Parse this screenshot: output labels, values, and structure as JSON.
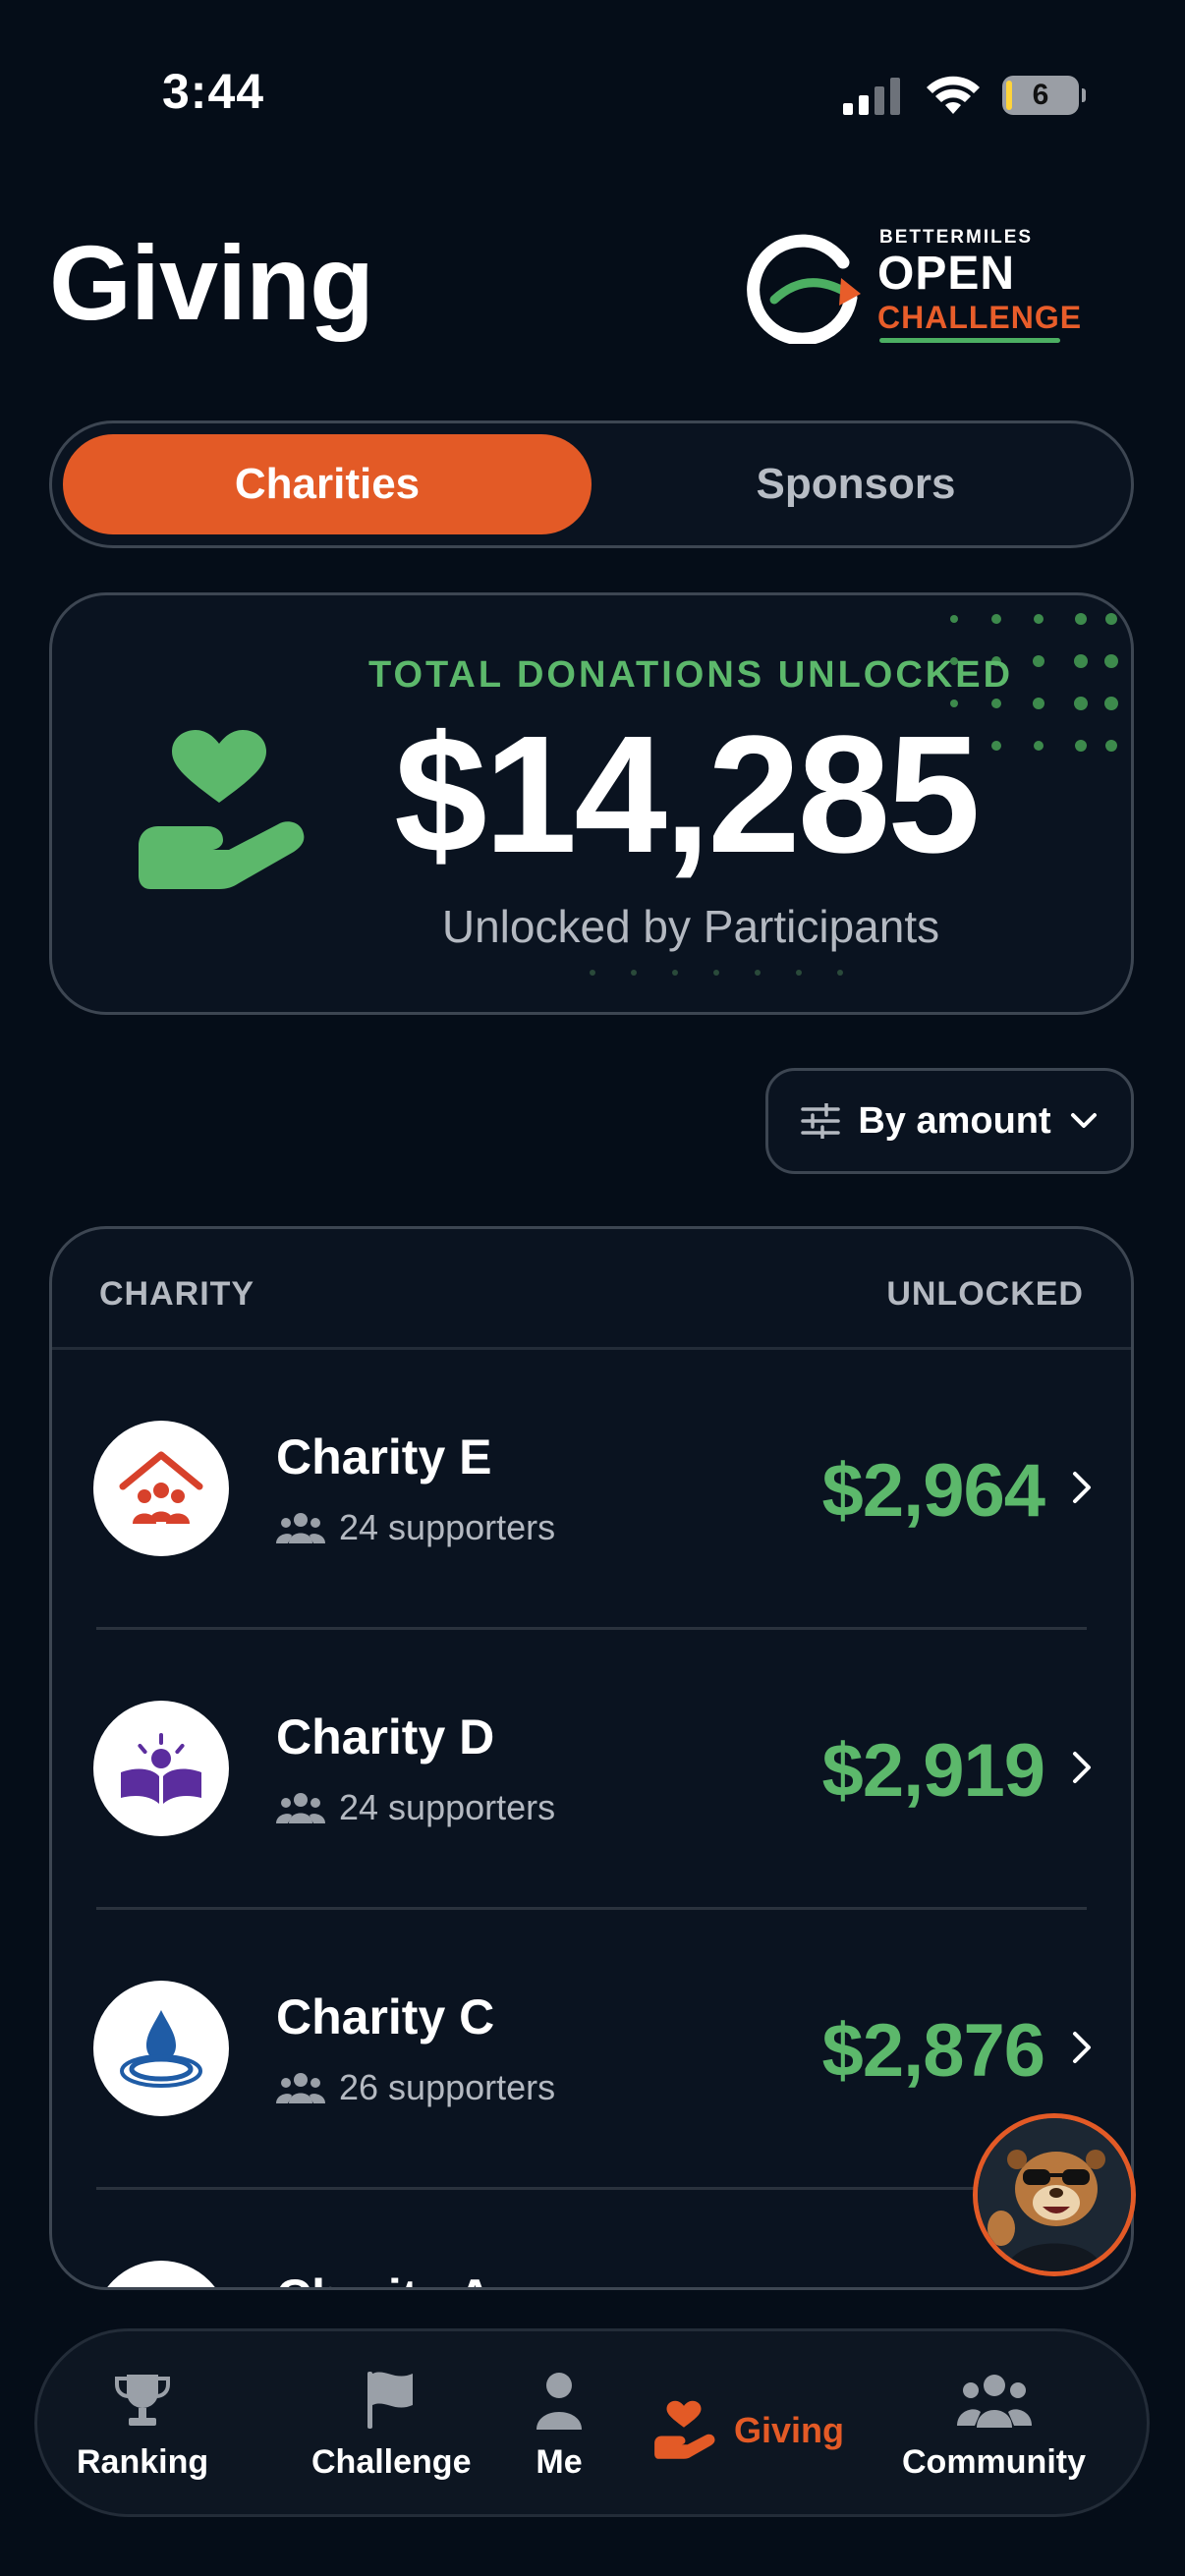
{
  "status_bar": {
    "time": "3:44",
    "battery": "6"
  },
  "header": {
    "title": "Giving",
    "logo": {
      "top": "BETTERMILES",
      "middle": "OPEN",
      "bottom": "CHALLENGE"
    }
  },
  "tabs": [
    {
      "label": "Charities",
      "active": true
    },
    {
      "label": "Sponsors",
      "active": false
    }
  ],
  "total": {
    "label": "TOTAL DONATIONS UNLOCKED",
    "amount": "$14,285",
    "subtitle": "Unlocked by Participants"
  },
  "sort": {
    "label": "By amount"
  },
  "list": {
    "col_left": "CHARITY",
    "col_right": "UNLOCKED",
    "rows": [
      {
        "name": "Charity E",
        "supporters": "24 supporters",
        "amount": "$2,964",
        "icon": "house-people-icon"
      },
      {
        "name": "Charity D",
        "supporters": "24 supporters",
        "amount": "$2,919",
        "icon": "book-icon"
      },
      {
        "name": "Charity C",
        "supporters": "26 supporters",
        "amount": "$2,876",
        "icon": "water-drop-icon"
      },
      {
        "name": "Charity A",
        "supporters": "",
        "amount": "",
        "icon": "charity-a-icon"
      }
    ]
  },
  "nav": [
    {
      "label": "Ranking",
      "icon": "trophy-icon"
    },
    {
      "label": "Challenge",
      "icon": "flag-icon"
    },
    {
      "label": "Me",
      "icon": "person-icon"
    },
    {
      "label": "Giving",
      "icon": "heart-hand-icon",
      "active": true
    },
    {
      "label": "Community",
      "icon": "group-icon"
    }
  ],
  "colors": {
    "accent": "#e35a26",
    "green": "#5cb86b",
    "background": "#050d18"
  }
}
